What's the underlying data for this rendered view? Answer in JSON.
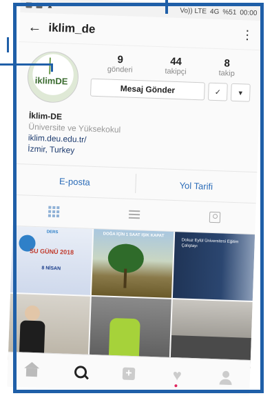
{
  "status": {
    "net": "Vo)) LTE",
    "signal": "4G",
    "battery": "%51",
    "time": "00:00"
  },
  "header": {
    "back_icon": "arrow-left-icon",
    "username": "iklim_de",
    "more_icon": "kebab-icon"
  },
  "profile": {
    "avatar_text": "iklimDE",
    "avatar_de": "DE",
    "stats": [
      {
        "num": "9",
        "label": "gönderi"
      },
      {
        "num": "44",
        "label": "takipçi"
      },
      {
        "num": "8",
        "label": "takip"
      }
    ],
    "message_label": "Mesaj Gönder",
    "follow_icon": "✓",
    "dropdown_icon": "▾"
  },
  "bio": {
    "name": "İklim-DE",
    "category": "Üniversite ve Yüksekokul",
    "link": "iklim.deu.edu.tr/",
    "location": "İzmir, Turkey"
  },
  "contact": {
    "email_label": "E-posta",
    "directions_label": "Yol Tarifi"
  },
  "posts": [
    {
      "top": "DERS",
      "caption": "SU GÜNÜ 2018",
      "sub": "8 NİSAN"
    },
    {
      "top": "DOĞA İÇİN 1 SAAT IŞIK KAPAT",
      "caption": "",
      "sub": ""
    },
    {
      "top": "",
      "caption": "",
      "sub": "Dokuz Eylül Üniversitesi Eğitim Çalıştayı"
    },
    {
      "top": "",
      "caption": "",
      "sub": ""
    },
    {
      "top": "",
      "caption": "",
      "sub": ""
    },
    {
      "top": "",
      "caption": "",
      "sub": ""
    }
  ]
}
